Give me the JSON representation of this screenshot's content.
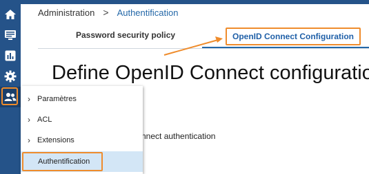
{
  "colors": {
    "sidebar": "#255389",
    "accent_orange": "#ef8c2c",
    "link_blue": "#2468a8",
    "selected_bg": "#d3e6f6"
  },
  "sidebar": {
    "icons": [
      "home-icon",
      "monitor-icon",
      "chart-icon",
      "gear-icon",
      "users-icon"
    ],
    "active": "users-icon"
  },
  "breadcrumb": {
    "root": "Administration",
    "separator": ">",
    "current": "Authentification"
  },
  "tabs": [
    {
      "label": "Password security policy",
      "active": false
    },
    {
      "label": "OpenID Connect Configuration",
      "active": true
    }
  ],
  "main": {
    "heading": "Define OpenID Connect configuration",
    "partial_text": "nnect authentication"
  },
  "menu": {
    "items": [
      {
        "label": "Paramètres",
        "chevron": "›"
      },
      {
        "label": "ACL",
        "chevron": "›"
      },
      {
        "label": "Extensions",
        "chevron": "›"
      },
      {
        "label": "Authentification",
        "chevron": "",
        "selected": true
      }
    ]
  }
}
